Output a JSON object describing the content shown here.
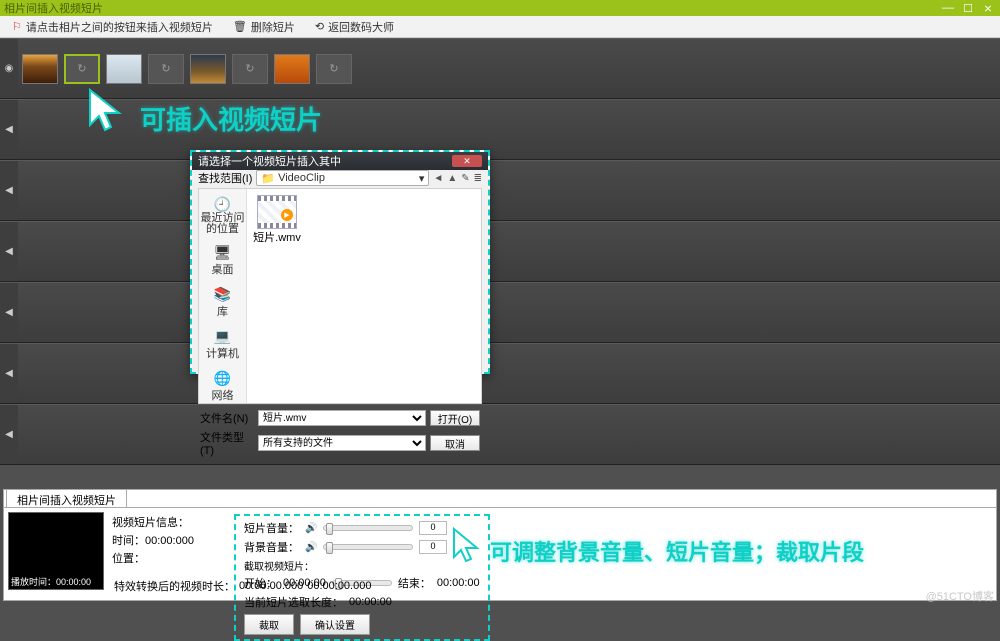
{
  "titlebar": {
    "title": "相片间插入视频短片",
    "min": "––",
    "max": "☐",
    "close": "⨯"
  },
  "toolbar": {
    "hint": "请点击相片之间的按钮来插入视频短片",
    "del": "删除短片",
    "back": "返回数码大师",
    "hint_icon": "⚐",
    "del_icon": "🗑",
    "back_icon": "⟲"
  },
  "callouts": {
    "c1": "可插入视频短片",
    "c2": "可调整背景音量、短片音量；裁取片段"
  },
  "dialog": {
    "title": "请选择一个视频短片插入其中",
    "range_lbl": "查找范围(I)",
    "folder": "VideoClip",
    "folder_icon": "📁",
    "nav": {
      "back": "◄",
      "up": "▲",
      "new": "✎",
      "view": "≣"
    },
    "sidebar": [
      {
        "icon": "🕘",
        "label": "最近访问的位置"
      },
      {
        "icon": "🖥",
        "label": "桌面"
      },
      {
        "icon": "📚",
        "label": "库"
      },
      {
        "icon": "💻",
        "label": "计算机"
      },
      {
        "icon": "🌐",
        "label": "网络"
      }
    ],
    "file": {
      "name": "短片.wmv",
      "play": "▶"
    },
    "fn_lbl": "文件名(N)",
    "fn_val": "短片.wmv",
    "ft_lbl": "文件类型(T)",
    "ft_val": "所有支持的文件",
    "open": "打开(O)",
    "cancel": "取消"
  },
  "panel": {
    "tab": "相片间插入视频短片",
    "preview_lbl": "播放时间：00:00:00",
    "info": {
      "h": "视频短片信息：",
      "t_lbl": "时间：",
      "t": "00:00:000",
      "p_lbl": "位置："
    },
    "insert": {
      "lbl": "特效转换后的视频时长：",
      "d1": "00:00:00.000",
      "d2": "00:00:00.000"
    },
    "vol": {
      "clip_lbl": "短片音量：",
      "bg_lbl": "背景音量：",
      "v": "0",
      "spk": "🔊"
    },
    "crop": {
      "h": "截取视频短片：",
      "start_lbl": "开始：",
      "end_lbl": "结束：",
      "t": "00:00:00"
    },
    "cur": {
      "lbl": "当前短片选取长度：",
      "t": "00:00:00"
    },
    "btn": {
      "crop": "裁取",
      "ok": "确认设置"
    }
  },
  "watermark": "@51CTO博客",
  "trans_glyph": "↻"
}
